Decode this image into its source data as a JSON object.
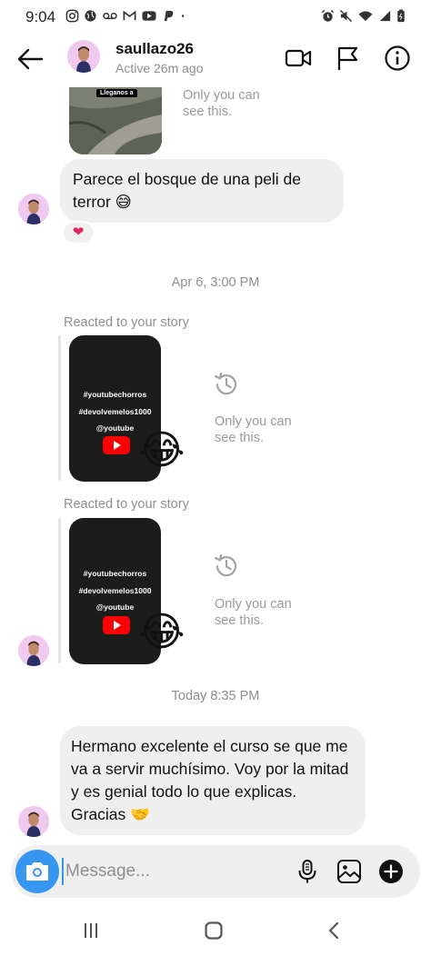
{
  "status_bar": {
    "time": "9:04",
    "left_icons": [
      "instagram-icon",
      "globe-icon",
      "voicemail-icon",
      "gmail-icon",
      "youtube-icon",
      "paypal-icon",
      "dot-icon"
    ],
    "right_icons": [
      "alarm-icon",
      "mute-icon",
      "wifi-icon",
      "signal-icon",
      "battery-icon"
    ]
  },
  "header": {
    "username": "saullazo26",
    "status": "Active 26m ago"
  },
  "chat": {
    "top_story_caption": "Only you can see this.",
    "photo_text": "Lleganos a",
    "message1": "Parece el bosque de una peli de terror 😅",
    "message1_reaction": "❤",
    "timestamp1": "Apr 6, 3:00 PM",
    "reacted_label": "Reacted to your story",
    "story_lines": [
      "#youtubechorros",
      "#devolvemelos1000",
      "@youtube"
    ],
    "story_reaction_emoji": "😂",
    "only_you_caption": "Only you can see this.",
    "timestamp2": "Today 8:35 PM",
    "message2": "Hermano excelente el curso se que me va a servir muchísimo. Voy por la mitad y es genial todo lo que explicas. Gracias 🤝"
  },
  "composer": {
    "placeholder": "Message..."
  },
  "colors": {
    "accent": "#3797f0",
    "bubble": "#efefef",
    "muted_text": "#8e8e8e",
    "heart": "#e0245e",
    "youtube_red": "#ff0000"
  }
}
